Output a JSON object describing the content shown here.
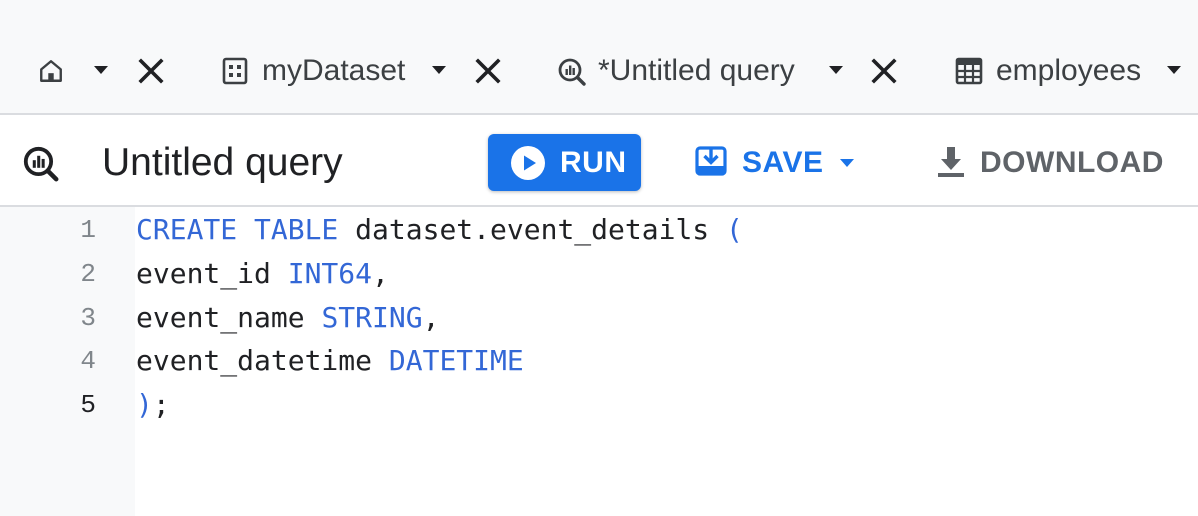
{
  "tabs": [
    {
      "label": "",
      "icon": "home-icon"
    },
    {
      "label": "myDataset",
      "icon": "dataset-icon"
    },
    {
      "label": "*Untitled query",
      "icon": "query-icon"
    },
    {
      "label": "employees",
      "icon": "table-icon"
    }
  ],
  "query": {
    "title": "Untitled query",
    "icon": "query-icon"
  },
  "toolbar": {
    "run_label": "RUN",
    "save_label": "SAVE",
    "download_label": "DOWNLOAD"
  },
  "editor": {
    "current_line": 5,
    "lines": [
      {
        "number": "1",
        "segments": [
          {
            "text": "CREATE TABLE",
            "type": "keyword"
          },
          {
            "text": " dataset.event_details ",
            "type": "text"
          },
          {
            "text": "(",
            "type": "punct"
          }
        ]
      },
      {
        "number": "2",
        "segments": [
          {
            "text": "event_id ",
            "type": "text"
          },
          {
            "text": "INT64",
            "type": "keyword"
          },
          {
            "text": ",",
            "type": "text"
          }
        ]
      },
      {
        "number": "3",
        "segments": [
          {
            "text": "event_name ",
            "type": "text"
          },
          {
            "text": "STRING",
            "type": "keyword"
          },
          {
            "text": ",",
            "type": "text"
          }
        ]
      },
      {
        "number": "4",
        "segments": [
          {
            "text": "event_datetime ",
            "type": "text"
          },
          {
            "text": "DATETIME",
            "type": "keyword"
          }
        ]
      },
      {
        "number": "5",
        "segments": [
          {
            "text": ")",
            "type": "punct"
          },
          {
            "text": ";",
            "type": "text"
          }
        ]
      }
    ]
  },
  "colors": {
    "accent": "#1a73e8",
    "keyword": "#3367d6",
    "text": "#202124",
    "muted": "#5f6368"
  }
}
